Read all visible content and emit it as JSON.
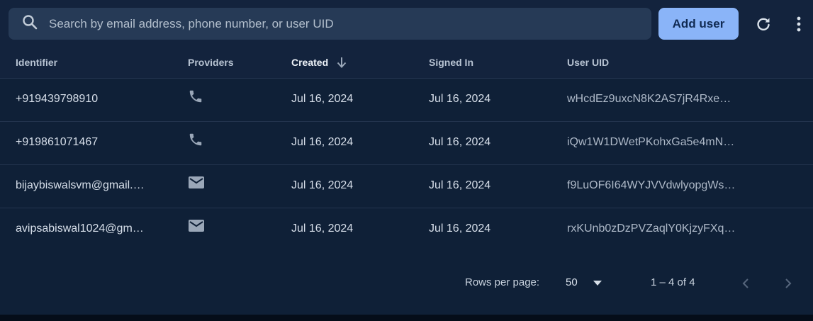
{
  "search": {
    "placeholder": "Search by email address, phone number, or user UID",
    "value": ""
  },
  "toolbar": {
    "add_user_label": "Add user"
  },
  "columns": {
    "identifier": "Identifier",
    "providers": "Providers",
    "created": "Created",
    "signed_in": "Signed In",
    "user_uid": "User UID"
  },
  "rows": [
    {
      "identifier": "+919439798910",
      "provider_icon": "phone-icon",
      "created": "Jul 16, 2024",
      "signed_in": "Jul 16, 2024",
      "uid": "wHcdEz9uxcN8K2AS7jR4Rxe…"
    },
    {
      "identifier": "+919861071467",
      "provider_icon": "phone-icon",
      "created": "Jul 16, 2024",
      "signed_in": "Jul 16, 2024",
      "uid": "iQw1W1DWetPKohxGa5e4mN…"
    },
    {
      "identifier": "bijaybiswalsvm@gmail.…",
      "provider_icon": "email-icon",
      "created": "Jul 16, 2024",
      "signed_in": "Jul 16, 2024",
      "uid": "f9LuOF6I64WYJVVdwlyopgWs…"
    },
    {
      "identifier": "avipsabiswal1024@gm…",
      "provider_icon": "email-icon",
      "created": "Jul 16, 2024",
      "signed_in": "Jul 16, 2024",
      "uid": "rxKUnb0zDzPVZaqlY0KjzyFXq…"
    }
  ],
  "pagination": {
    "rows_per_page_label": "Rows per page:",
    "rows_per_page_value": "50",
    "range_text": "1 – 4 of 4"
  },
  "colors": {
    "accent": "#8ab4f8",
    "background": "#0f2037",
    "header": "#13233d"
  }
}
